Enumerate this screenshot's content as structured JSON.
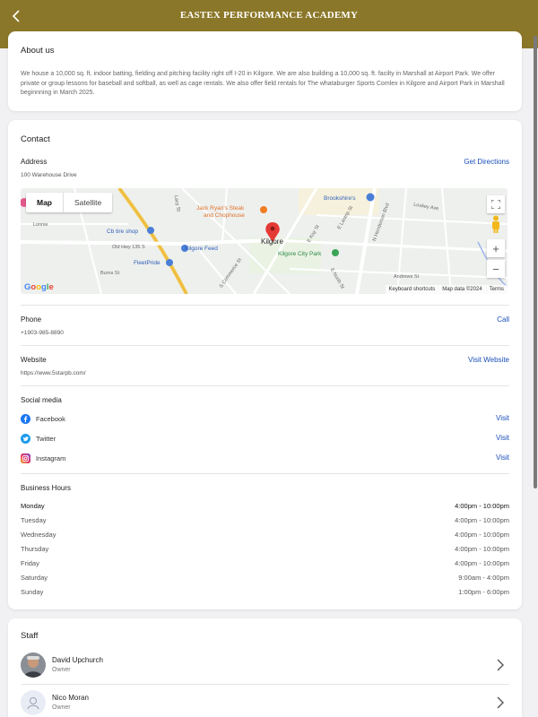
{
  "header": {
    "title": "EASTEX PERFORMANCE ACADEMY"
  },
  "about": {
    "title": "About us",
    "text": "We house a 10,000 sq. ft. indoor batting, fielding and pitching facility right off I-20 in Kilgore.  We are also building a 10,000 sq. ft. facilty in Marshall at Airport Park.  We offer private or group lessons for baseball and softball, as well as cage rentals.  We also offer field rentals for The whataburger Sports Comlex in Kilgore and Airport Park in Marshall beginnning in March 2025."
  },
  "contact": {
    "title": "Contact",
    "address": {
      "label": "Address",
      "value": "100 Warehouse Drive",
      "action": "Get Directions"
    },
    "map": {
      "toggle_map": "Map",
      "toggle_satellite": "Satellite",
      "labels": {
        "jack_ryans": "Jack Ryan's Steak",
        "jack_ryans2": "and Chophouse",
        "brookshires": "Brookshire's",
        "kilgore": "Kilgore",
        "cb_tire": "Cb tire shop",
        "kilgore_feed": "Kilgore Feed",
        "fleetpride": "FleetPride",
        "city_park": "Kilgore City Park",
        "old_hwy": "Old Hwy 135 S",
        "burns": "Burns St",
        "lonnie": "Lonnie",
        "henderson": "N Henderson Blvd",
        "lacy": "Lacy St",
        "commerce": "S Commerce St",
        "lantrip": "E Lantrip St",
        "north": "E North St",
        "andrews": "Andrews St",
        "lookey": "Lookey Ave",
        "kay": "E Kay St"
      },
      "google": "Google",
      "keyboard": "Keyboard shortcuts",
      "map_data": "Map data ©2024",
      "terms": "Terms",
      "zoom_in": "+",
      "zoom_out": "−"
    },
    "phone": {
      "label": "Phone",
      "value": "+1903-985-8890",
      "action": "Call"
    },
    "website": {
      "label": "Website",
      "value": "https://www.5starpb.com/",
      "action": "Visit Website"
    },
    "social": {
      "label": "Social media",
      "items": [
        {
          "name": "Facebook",
          "action": "Visit"
        },
        {
          "name": "Twitter",
          "action": "Visit"
        },
        {
          "name": "Instagram",
          "action": "Visit"
        }
      ]
    },
    "hours": {
      "label": "Business Hours",
      "rows": [
        {
          "day": "Monday",
          "time": "4:00pm - 10:00pm"
        },
        {
          "day": "Tuesday",
          "time": "4:00pm - 10:00pm"
        },
        {
          "day": "Wednesday",
          "time": "4:00pm - 10:00pm"
        },
        {
          "day": "Thursday",
          "time": "4:00pm - 10:00pm"
        },
        {
          "day": "Friday",
          "time": "4:00pm - 10:00pm"
        },
        {
          "day": "Saturday",
          "time": "9:00am - 4:00pm"
        },
        {
          "day": "Sunday",
          "time": "1:00pm - 6:00pm"
        }
      ]
    }
  },
  "staff": {
    "title": "Staff",
    "members": [
      {
        "name": "David Upchurch",
        "role": "Owner"
      },
      {
        "name": "Nico Moran",
        "role": "Owner"
      }
    ]
  },
  "colors": {
    "header": "#8b7729",
    "link": "#1a4fb8"
  }
}
